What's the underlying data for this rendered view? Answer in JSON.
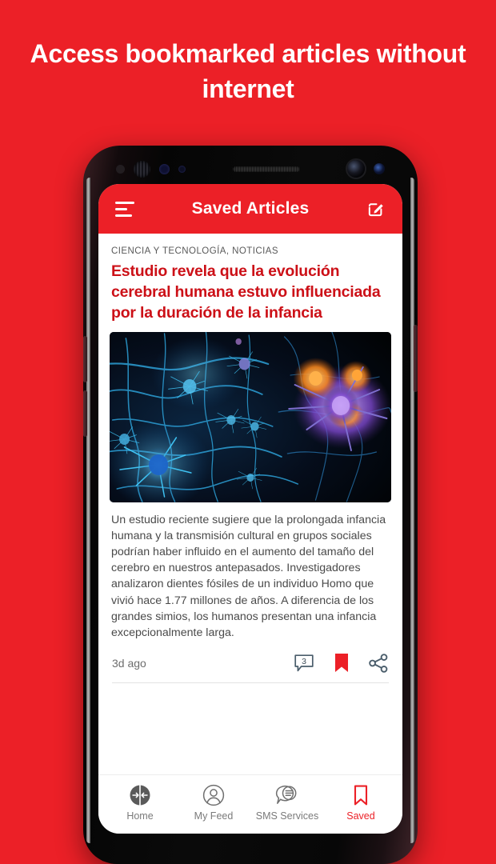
{
  "promo": {
    "headline": "Access bookmarked articles without internet"
  },
  "colors": {
    "brand_red": "#ec2027",
    "headline_red": "#cc1017",
    "muted_text": "#7a7a7a"
  },
  "phone": {
    "appbar": {
      "title": "Saved Articles",
      "menu_icon": "hamburger-menu-icon",
      "compose_icon": "compose-edit-icon"
    },
    "article": {
      "category": "CIENCIA Y TECNOLOGÍA, NOTICIAS",
      "headline": "Estudio revela que la evolución cerebral humana estuvo influenciada por la duración de la infancia",
      "image_alt": "neuron-network-illustration",
      "body": "Un estudio reciente sugiere que la prolongada infancia humana y la transmisión cultural en grupos sociales podrían haber influido en el aumento del tamaño del cerebro en nuestros antepasados. Investigadores analizaron dientes fósiles de un individuo Homo que vivió hace 1.77 millones de años. A diferencia de los grandes simios, los humanos presentan una infancia excepcionalmente larga.",
      "timestamp": "3d ago",
      "comment_count": "3",
      "bookmark_icon": "bookmark-filled-icon",
      "share_icon": "share-icon",
      "comment_icon": "comment-bubble-icon"
    },
    "bottomnav": {
      "items": [
        {
          "label": "Home",
          "icon": "home-target-icon",
          "active": false
        },
        {
          "label": "My Feed",
          "icon": "user-circle-icon",
          "active": false
        },
        {
          "label": "SMS Services",
          "icon": "chat-lines-icon",
          "active": false
        },
        {
          "label": "Saved",
          "icon": "bookmark-outline-icon",
          "active": true
        }
      ]
    }
  }
}
